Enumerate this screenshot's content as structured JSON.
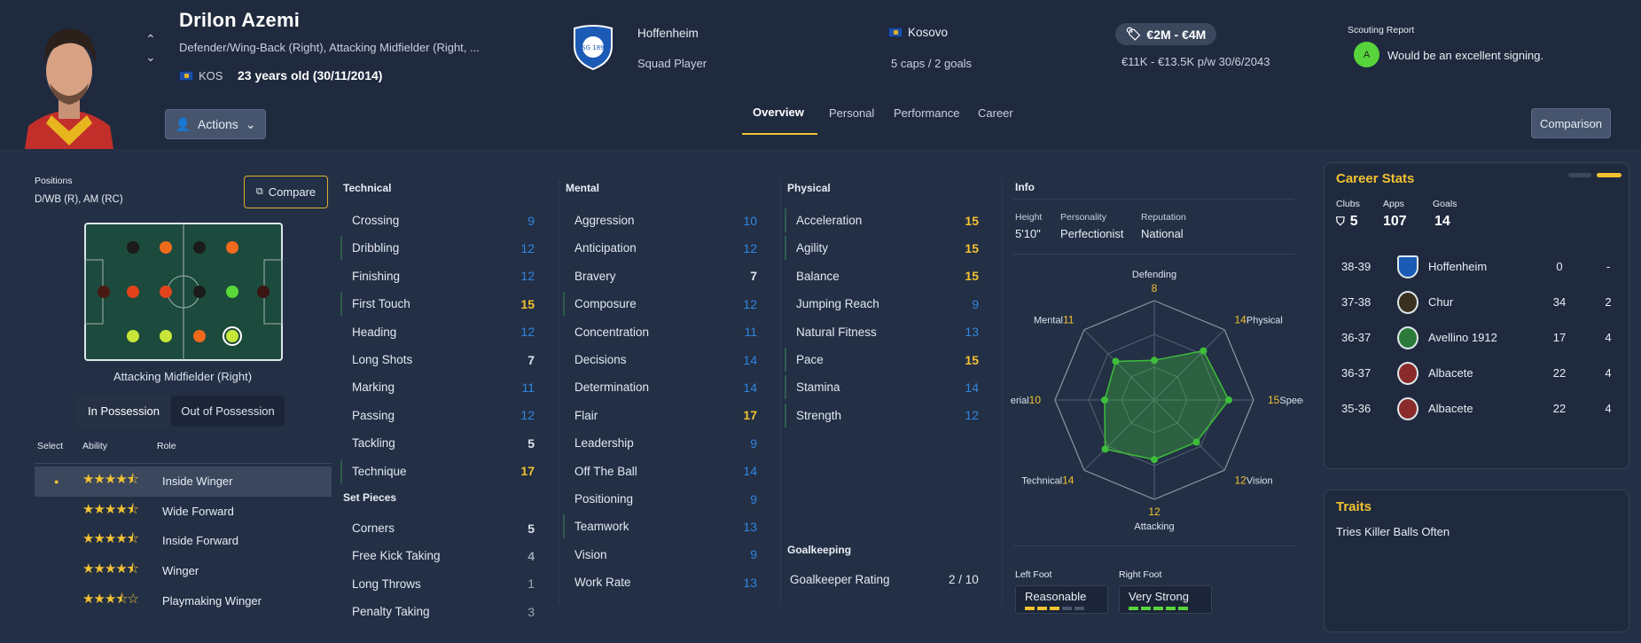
{
  "player": {
    "name": "Drilon Azemi",
    "positions_text": "Defender/Wing-Back (Right), Attacking Midfielder (Right, ...",
    "nation_code": "KOS",
    "age": "23 years old (30/11/2014)"
  },
  "club": {
    "name": "Hoffenheim",
    "status": "Squad Player",
    "badge_text": "TSG 1899"
  },
  "nation": {
    "name": "Kosovo",
    "caps": "5 caps / 2 goals"
  },
  "value": {
    "range": "€2M - €4M",
    "wage": "€11K - €13.5K p/w 30/6/2043"
  },
  "scouting": {
    "title": "Scouting Report",
    "grade": "A",
    "text": "Would be an excellent signing."
  },
  "buttons": {
    "actions": "Actions",
    "comparison": "Comparison",
    "compare": "Compare"
  },
  "tabs": [
    "Overview",
    "Personal",
    "Performance",
    "Career"
  ],
  "positions": {
    "label": "Positions",
    "value": "D/WB (R), AM (RC)",
    "selected": "Attacking Midfielder (Right)"
  },
  "pitch_dots": [
    {
      "c": "#1b1b1b"
    },
    {
      "c": "#f06a1c"
    },
    {
      "c": "#1b1b1b"
    },
    {
      "c": "#f06a1c"
    },
    {
      "c": "#4a1a14"
    },
    {
      "c": "#e3431c"
    },
    {
      "c": "#e3431c"
    },
    {
      "c": "#1b1b1b"
    },
    {
      "c": "#5ad83a"
    },
    {
      "c": "#3a1612"
    },
    {
      "c": "#c8e63a"
    },
    {
      "c": "#c8e63a"
    },
    {
      "c": "#f06a1c"
    },
    {
      "c": "#c8e63a"
    }
  ],
  "possession": {
    "in": "In Possession",
    "out": "Out of Possession"
  },
  "roles_header": {
    "select": "Select",
    "ability": "Ability",
    "role": "Role"
  },
  "roles": [
    {
      "name": "Inside Winger",
      "stars": 4.5,
      "selected": true
    },
    {
      "name": "Wide Forward",
      "stars": 4.5
    },
    {
      "name": "Inside Forward",
      "stars": 4.5
    },
    {
      "name": "Winger",
      "stars": 4.5
    },
    {
      "name": "Playmaking Winger",
      "stars": 3.5
    }
  ],
  "technical": {
    "title": "Technical",
    "items": [
      {
        "n": "Crossing",
        "v": "9"
      },
      {
        "n": "Dribbling",
        "v": "12"
      },
      {
        "n": "Finishing",
        "v": "12"
      },
      {
        "n": "First Touch",
        "v": "15"
      },
      {
        "n": "Heading",
        "v": "12"
      },
      {
        "n": "Long Shots",
        "v": "7"
      },
      {
        "n": "Marking",
        "v": "11"
      },
      {
        "n": "Passing",
        "v": "12"
      },
      {
        "n": "Tackling",
        "v": "5"
      },
      {
        "n": "Technique",
        "v": "17"
      }
    ]
  },
  "set_pieces": {
    "title": "Set Pieces",
    "items": [
      {
        "n": "Corners",
        "v": "5"
      },
      {
        "n": "Free Kick Taking",
        "v": "4"
      },
      {
        "n": "Long Throws",
        "v": "1"
      },
      {
        "n": "Penalty Taking",
        "v": "3"
      }
    ]
  },
  "mental": {
    "title": "Mental",
    "items": [
      {
        "n": "Aggression",
        "v": "10"
      },
      {
        "n": "Anticipation",
        "v": "12"
      },
      {
        "n": "Bravery",
        "v": "7"
      },
      {
        "n": "Composure",
        "v": "12"
      },
      {
        "n": "Concentration",
        "v": "11"
      },
      {
        "n": "Decisions",
        "v": "14"
      },
      {
        "n": "Determination",
        "v": "14"
      },
      {
        "n": "Flair",
        "v": "17"
      },
      {
        "n": "Leadership",
        "v": "9"
      },
      {
        "n": "Off The Ball",
        "v": "14"
      },
      {
        "n": "Positioning",
        "v": "9"
      },
      {
        "n": "Teamwork",
        "v": "13"
      },
      {
        "n": "Vision",
        "v": "9"
      },
      {
        "n": "Work Rate",
        "v": "13"
      }
    ]
  },
  "physical": {
    "title": "Physical",
    "items": [
      {
        "n": "Acceleration",
        "v": "15"
      },
      {
        "n": "Agility",
        "v": "15"
      },
      {
        "n": "Balance",
        "v": "15"
      },
      {
        "n": "Jumping Reach",
        "v": "9"
      },
      {
        "n": "Natural Fitness",
        "v": "13"
      },
      {
        "n": "Pace",
        "v": "15"
      },
      {
        "n": "Stamina",
        "v": "14"
      },
      {
        "n": "Strength",
        "v": "12"
      }
    ]
  },
  "goalkeeping": {
    "title": "Goalkeeping",
    "label": "Goalkeeper Rating",
    "value": "2 / 10"
  },
  "info": {
    "title": "Info",
    "height_label": "Height",
    "height": "5'10\"",
    "personality_label": "Personality",
    "personality": "Perfectionist",
    "reputation_label": "Reputation",
    "reputation": "National"
  },
  "radar": {
    "axes": [
      {
        "label": "Defending",
        "v": 8
      },
      {
        "label": "Physical",
        "v": 14
      },
      {
        "label": "Speed",
        "v": 15
      },
      {
        "label": "Vision",
        "v": 12
      },
      {
        "label": "Attacking",
        "v": 12
      },
      {
        "label": "Technical",
        "v": 14
      },
      {
        "label": "Aerial",
        "v": 10
      },
      {
        "label": "Mental",
        "v": 11
      }
    ],
    "max": 20
  },
  "feet": {
    "left_label": "Left Foot",
    "left": "Reasonable",
    "left_level": 3,
    "right_label": "Right Foot",
    "right": "Very Strong",
    "right_level": 5
  },
  "career": {
    "title": "Career Stats",
    "clubs_label": "Clubs",
    "clubs": "5",
    "apps_label": "Apps",
    "apps": "107",
    "goals_label": "Goals",
    "goals": "14",
    "rows": [
      {
        "season": "38-39",
        "club": "Hoffenheim",
        "apps": "0",
        "goals": "-"
      },
      {
        "season": "37-38",
        "club": "Chur",
        "apps": "34",
        "goals": "2"
      },
      {
        "season": "36-37",
        "club": "Avellino 1912",
        "apps": "17",
        "goals": "4"
      },
      {
        "season": "36-37",
        "club": "Albacete",
        "apps": "22",
        "goals": "4"
      },
      {
        "season": "35-36",
        "club": "Albacete",
        "apps": "22",
        "goals": "4"
      }
    ]
  },
  "traits": {
    "title": "Traits",
    "text": "Tries Killer Balls Often"
  },
  "colors": {
    "accent": "#f2c230",
    "blue": "#2f86e0",
    "green": "#3fbe3a"
  }
}
